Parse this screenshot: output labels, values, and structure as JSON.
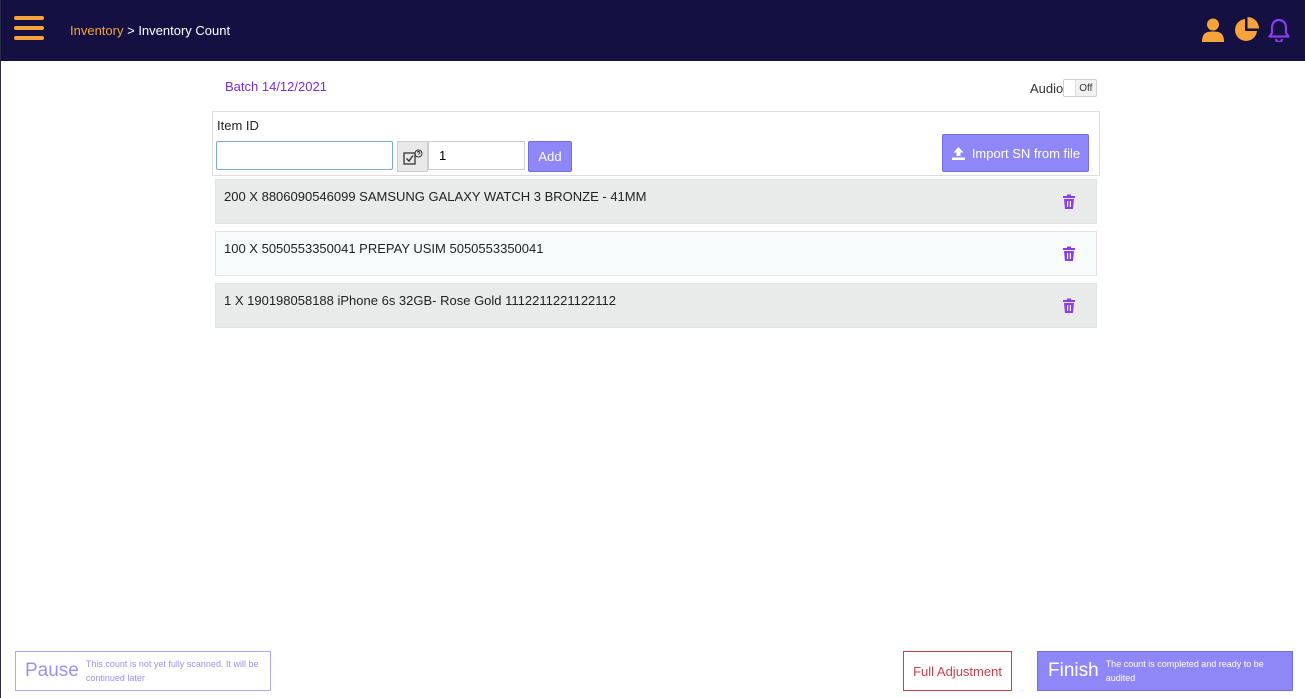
{
  "header": {
    "breadcrumb_link": "Inventory",
    "breadcrumb_sep": " > ",
    "breadcrumb_current": "Inventory Count",
    "icons": [
      "user-icon",
      "pie-chart-icon",
      "bell-icon"
    ],
    "colors": {
      "bar": "#141042",
      "accent": "#f5a33a",
      "bell": "#8b3cf0"
    }
  },
  "batch": {
    "label": "Batch 14/12/2021"
  },
  "audio": {
    "label": "Audio",
    "state": "Off"
  },
  "entry": {
    "item_id_label": "Item ID",
    "item_id_value": "",
    "quantity_value": "1",
    "add_label": "Add",
    "import_label": "Import SN from file"
  },
  "items": [
    {
      "text": "200 X    8806090546099 SAMSUNG GALAXY WATCH 3 BRONZE - 41MM"
    },
    {
      "text": "100 X    5050553350041 PREPAY USIM 5050553350041"
    },
    {
      "text": "1 X    190198058188 iPhone 6s 32GB- Rose Gold 1112211221122112"
    }
  ],
  "footer": {
    "pause_label": "Pause",
    "pause_desc": "This count is not yet fully scanned. It will be continued later",
    "full_adjustment_label": "Full Adjustment",
    "finish_label": "Finish",
    "finish_desc": "The count is completed and ready to be audited"
  }
}
